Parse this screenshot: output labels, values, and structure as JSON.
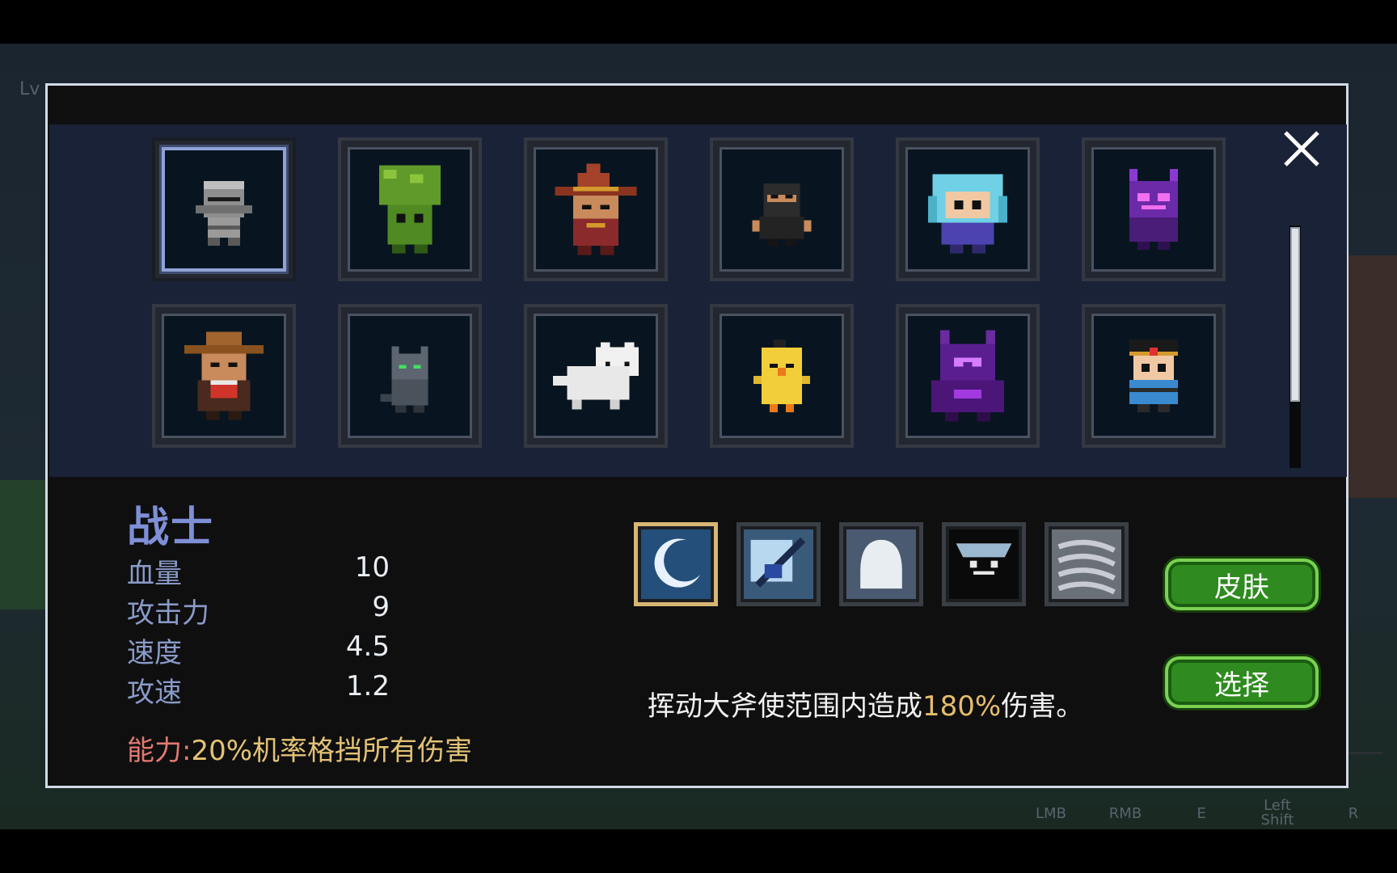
{
  "hud": {
    "level_label": "Lv"
  },
  "hotkeys": [
    "LMB",
    "RMB",
    "E",
    "Left Shift",
    "R"
  ],
  "roster": {
    "selected_index": 0,
    "characters": [
      {
        "icon": "knight-helmet-icon"
      },
      {
        "icon": "broccoli-icon"
      },
      {
        "icon": "witch-icon"
      },
      {
        "icon": "ninja-icon"
      },
      {
        "icon": "blue-hair-girl-icon"
      },
      {
        "icon": "purple-demon-icon"
      },
      {
        "icon": "cowboy-icon"
      },
      {
        "icon": "gray-cat-icon"
      },
      {
        "icon": "white-cat-icon"
      },
      {
        "icon": "yellow-chick-icon"
      },
      {
        "icon": "purple-armor-icon"
      },
      {
        "icon": "headband-boy-icon"
      }
    ],
    "scroll_fraction_visible": 0.72
  },
  "character": {
    "name": "战士",
    "stats": [
      {
        "label": "血量",
        "value": "10"
      },
      {
        "label": "攻击力",
        "value": "9"
      },
      {
        "label": "速度",
        "value": "4.5"
      },
      {
        "label": "攻速",
        "value": "1.2"
      }
    ],
    "ability_label": "能力:",
    "ability_text": "20%机率格挡所有伤害"
  },
  "skills": {
    "active_index": 0,
    "items": [
      {
        "icon": "crescent-slash-icon"
      },
      {
        "icon": "axe-icon"
      },
      {
        "icon": "ghost-shroud-icon"
      },
      {
        "icon": "spirit-face-icon"
      },
      {
        "icon": "whirlwind-icon"
      }
    ],
    "description_before": "挥动大斧使范围内造成",
    "description_highlight": "180%",
    "description_after": "伤害。"
  },
  "buttons": {
    "skin": "皮肤",
    "select": "选择"
  },
  "colors": {
    "panel_border": "#d3dae6",
    "roster_bg": "#1a2237",
    "name_color": "#7f8fd6",
    "highlight": "#e4bd6c",
    "button_green": "#2f8b1f"
  }
}
